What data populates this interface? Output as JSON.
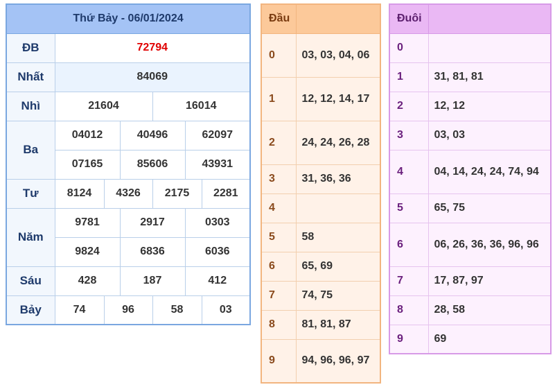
{
  "results": {
    "title": "Thứ Bảy - 06/01/2024",
    "rows": [
      {
        "label": "ĐB",
        "values": [
          "72794"
        ]
      },
      {
        "label": "Nhất",
        "values": [
          "84069"
        ]
      },
      {
        "label": "Nhì",
        "values": [
          "21604",
          "16014"
        ]
      },
      {
        "label": "Ba",
        "values": [
          "04012",
          "40496",
          "62097",
          "07165",
          "85606",
          "43931"
        ]
      },
      {
        "label": "Tư",
        "values": [
          "8124",
          "4326",
          "2175",
          "2281"
        ]
      },
      {
        "label": "Năm",
        "values": [
          "9781",
          "2917",
          "0303",
          "9824",
          "6836",
          "6036"
        ]
      },
      {
        "label": "Sáu",
        "values": [
          "428",
          "187",
          "412"
        ]
      },
      {
        "label": "Bảy",
        "values": [
          "74",
          "96",
          "58",
          "03"
        ]
      }
    ]
  },
  "dau": {
    "header": "Đầu",
    "rows": [
      {
        "key": "0",
        "value": "03, 03, 04, 06"
      },
      {
        "key": "1",
        "value": "12, 12, 14, 17"
      },
      {
        "key": "2",
        "value": "24, 24, 26, 28"
      },
      {
        "key": "3",
        "value": "31, 36, 36"
      },
      {
        "key": "4",
        "value": ""
      },
      {
        "key": "5",
        "value": "58"
      },
      {
        "key": "6",
        "value": "65, 69"
      },
      {
        "key": "7",
        "value": "74, 75"
      },
      {
        "key": "8",
        "value": "81, 81, 87"
      },
      {
        "key": "9",
        "value": "94, 96, 96, 97"
      }
    ]
  },
  "duoi": {
    "header": "Đuôi",
    "rows": [
      {
        "key": "0",
        "value": ""
      },
      {
        "key": "1",
        "value": "31, 81, 81"
      },
      {
        "key": "2",
        "value": "12, 12"
      },
      {
        "key": "3",
        "value": "03, 03"
      },
      {
        "key": "4",
        "value": "04, 14, 24, 24, 74, 94"
      },
      {
        "key": "5",
        "value": "65, 75"
      },
      {
        "key": "6",
        "value": "06, 26, 36, 36, 96, 96"
      },
      {
        "key": "7",
        "value": "17, 87, 97"
      },
      {
        "key": "8",
        "value": "28, 58"
      },
      {
        "key": "9",
        "value": "69"
      }
    ]
  },
  "colors": {
    "special_prize": "#e00000",
    "results_header": "#a4c3f5",
    "dau_header": "#fcc99a",
    "duoi_header": "#eab8f4"
  }
}
